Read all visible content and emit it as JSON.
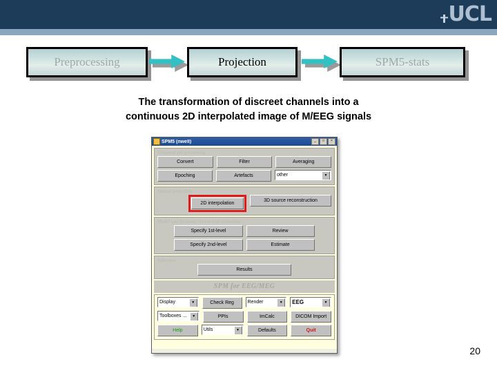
{
  "header": {
    "logo_text": "UCL",
    "bar_color": "#1c3c5a",
    "accent_color": "#8ba7be",
    "logo_color": "#aebfd1"
  },
  "flow": {
    "arrow_color": "#33c0c4",
    "steps": [
      {
        "label": "Preprocessing",
        "state": "dim"
      },
      {
        "label": "Projection",
        "state": "active"
      },
      {
        "label": "SPM5-stats",
        "state": "dim"
      }
    ]
  },
  "caption": {
    "line1": "The transformation of discreet channels into a",
    "line2": "continuous 2D interpolated image of M/EEG signals"
  },
  "spm_window": {
    "title": "SPM5 (nwell)",
    "title_buttons": [
      "_",
      "□",
      "×"
    ],
    "sections": [
      {
        "title": "Temporal pre-processing",
        "rows": [
          [
            {
              "type": "button",
              "label": "Convert"
            },
            {
              "type": "button",
              "label": "Filter"
            },
            {
              "type": "button",
              "label": "Averaging"
            }
          ],
          [
            {
              "type": "button",
              "label": "Epoching"
            },
            {
              "type": "button",
              "label": "Artefacts"
            },
            {
              "type": "select",
              "label": "other"
            }
          ]
        ]
      },
      {
        "title": "Spatial projection",
        "rows": [
          [
            {
              "type": "spacer",
              "label": ""
            },
            {
              "type": "button",
              "label": "2D interpolation",
              "highlight": true
            },
            {
              "type": "button",
              "label": "3D source reconstruction"
            }
          ]
        ]
      },
      {
        "title": "Model specification, review and estimation",
        "rows": [
          [
            {
              "type": "button",
              "label": "Specify 1st-level"
            },
            {
              "type": "button",
              "label": "Review"
            }
          ],
          [
            {
              "type": "button",
              "label": "Specify 2nd-level"
            },
            {
              "type": "button",
              "label": "Estimate"
            }
          ]
        ]
      },
      {
        "title": "Inference",
        "rows": [
          [
            {
              "type": "spacer",
              "label": ""
            },
            {
              "type": "button",
              "label": "Results"
            },
            {
              "type": "spacer",
              "label": ""
            }
          ]
        ]
      }
    ],
    "subtitle": "SPM for EEG/MEG",
    "bottom_rows": [
      [
        {
          "type": "select",
          "label": "Display"
        },
        {
          "type": "button",
          "label": "Check Reg"
        },
        {
          "type": "select",
          "label": "Render"
        },
        {
          "type": "select",
          "label": "EEG"
        }
      ],
      [
        {
          "type": "select",
          "label": "Toolboxes ..."
        },
        {
          "type": "button",
          "label": "PPIs"
        },
        {
          "type": "button",
          "label": "ImCalc"
        },
        {
          "type": "button",
          "label": "DICOM Import"
        }
      ],
      [
        {
          "type": "button",
          "label": "Help",
          "color": "green"
        },
        {
          "type": "select",
          "label": "Utils"
        },
        {
          "type": "button",
          "label": "Defaults"
        },
        {
          "type": "button",
          "label": "Quit",
          "color": "red"
        }
      ]
    ],
    "highlight_color": "#e01b1b"
  },
  "page_number": "20"
}
